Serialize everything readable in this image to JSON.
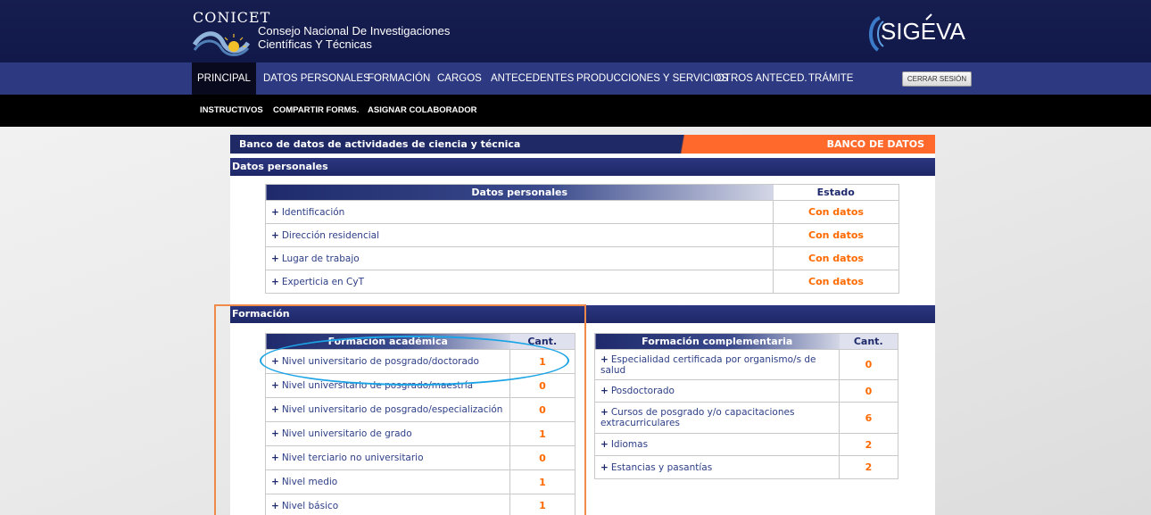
{
  "header": {
    "conicet": "CONICET",
    "org_line1": "Consejo Nacional De Investigaciones",
    "org_line2": "Científicas Y Técnicas",
    "sigeva": "SIGEVA"
  },
  "nav": {
    "items": [
      {
        "label": "PRINCIPAL"
      },
      {
        "label": "DATOS PERSONALES"
      },
      {
        "label": "FORMACIÓN"
      },
      {
        "label": "CARGOS"
      },
      {
        "label": "ANTECEDENTES"
      },
      {
        "label": "PRODUCCIONES Y SERVICIOS"
      },
      {
        "label": "OTROS ANTECED."
      },
      {
        "label": "TRÁMITE"
      }
    ],
    "logout": "CERRAR SESIÓN"
  },
  "subnav": {
    "items": [
      {
        "label": "INSTRUCTIVOS"
      },
      {
        "label": "COMPARTIR FORMS."
      },
      {
        "label": "ASIGNAR COLABORADOR"
      }
    ]
  },
  "bank": {
    "title": "Banco de datos de actividades de ciencia y técnica",
    "right": "BANCO DE DATOS"
  },
  "datos_personales": {
    "section": "Datos personales",
    "table_header": "Datos personales",
    "state_header": "Estado",
    "rows": [
      {
        "label": "Identificación",
        "state": "Con datos"
      },
      {
        "label": "Dirección residencial",
        "state": "Con datos"
      },
      {
        "label": "Lugar de trabajo",
        "state": "Con datos"
      },
      {
        "label": "Experticia en CyT",
        "state": "Con datos"
      }
    ]
  },
  "formacion": {
    "section": "Formación",
    "academica": {
      "header": "Formación académica",
      "cant": "Cant.",
      "rows": [
        {
          "label": "Nivel universitario de posgrado/doctorado",
          "count": "1"
        },
        {
          "label": "Nivel universitario de posgrado/maestría",
          "count": "0"
        },
        {
          "label": "Nivel universitario de posgrado/especialización",
          "count": "0"
        },
        {
          "label": "Nivel universitario de grado",
          "count": "1"
        },
        {
          "label": "Nivel terciario no universitario",
          "count": "0"
        },
        {
          "label": "Nivel medio",
          "count": "1"
        },
        {
          "label": "Nivel básico",
          "count": "1"
        }
      ]
    },
    "complementaria": {
      "header": "Formación complementaria",
      "cant": "Cant.",
      "rows": [
        {
          "label": "Especialidad certificada por organismo/s de salud",
          "count": "0"
        },
        {
          "label": "Posdoctorado",
          "count": "0"
        },
        {
          "label": "Cursos de posgrado y/o capacitaciones extracurriculares",
          "count": "6"
        },
        {
          "label": "Idiomas",
          "count": "2"
        },
        {
          "label": "Estancias y pasantías",
          "count": "2"
        }
      ]
    }
  },
  "colors": {
    "navy": "#1e2966",
    "orange": "#ff6a2c",
    "state_orange": "#ff6a00",
    "annotation_box": "#f08a4b",
    "annotation_ellipse": "#1ba3e6"
  }
}
